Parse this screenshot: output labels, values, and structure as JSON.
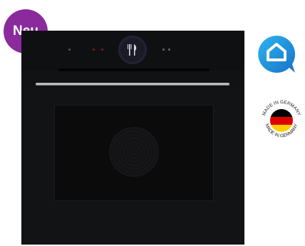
{
  "badge": {
    "label": "Neu",
    "color": "#8a2a9d"
  },
  "product": {
    "type": "built-in-oven",
    "finish_color": "#111214",
    "handle_color": "#c8c8c8"
  },
  "icons": {
    "smart_home": "home-chat-icon",
    "made_in": "made-in-germany-seal"
  },
  "seal": {
    "text": "MADE IN GERMANY",
    "flag_colors": [
      "#000000",
      "#dd0000",
      "#ffce00"
    ]
  },
  "accent_colors": {
    "smart_icon": "#1f8fd6"
  }
}
